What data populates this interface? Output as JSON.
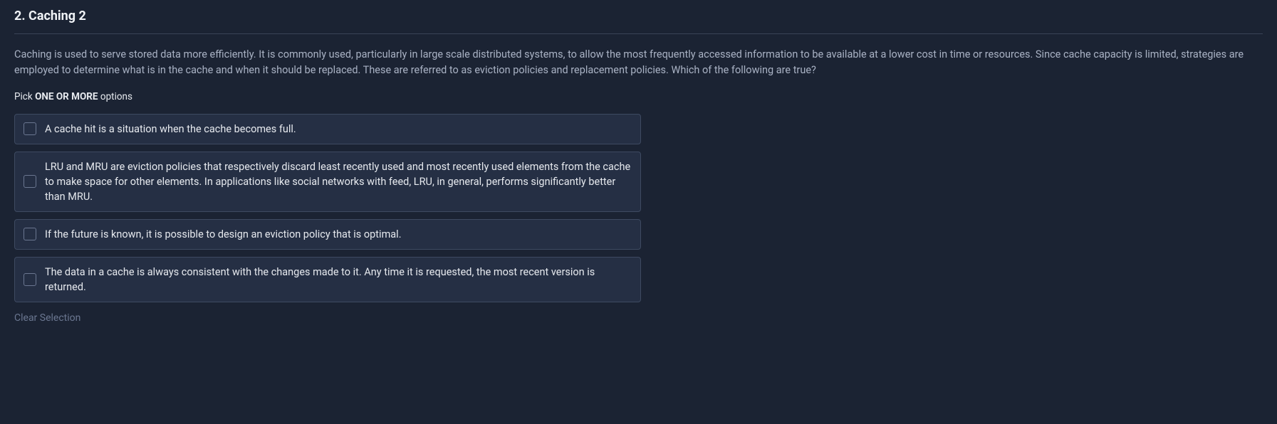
{
  "question": {
    "number": "2.",
    "title": "Caching 2",
    "body": "Caching is used to serve stored data more efficiently.  It is commonly used, particularly in large scale distributed systems, to allow the most frequently accessed information to be available at a lower cost in time or resources.  Since cache capacity is limited, strategies are employed to determine what is in the cache and when it should be replaced.  These are referred to as eviction policies and replacement policies.  Which of the following are true?",
    "instruction_prefix": "Pick ",
    "instruction_bold": "ONE OR MORE",
    "instruction_suffix": " options",
    "options": [
      {
        "text": "A cache hit is a situation when the cache becomes full."
      },
      {
        "text": "LRU and MRU are eviction policies that respectively discard least recently used and most recently used elements from the cache to make space for other elements. In applications like social networks with feed, LRU, in general, performs significantly better than MRU."
      },
      {
        "text": "If the future is known, it is possible to design an eviction policy that is optimal."
      },
      {
        "text": "The data in a cache is always consistent with the changes made to it. Any time it is requested, the most recent version is returned."
      }
    ],
    "clear_label": "Clear Selection"
  }
}
